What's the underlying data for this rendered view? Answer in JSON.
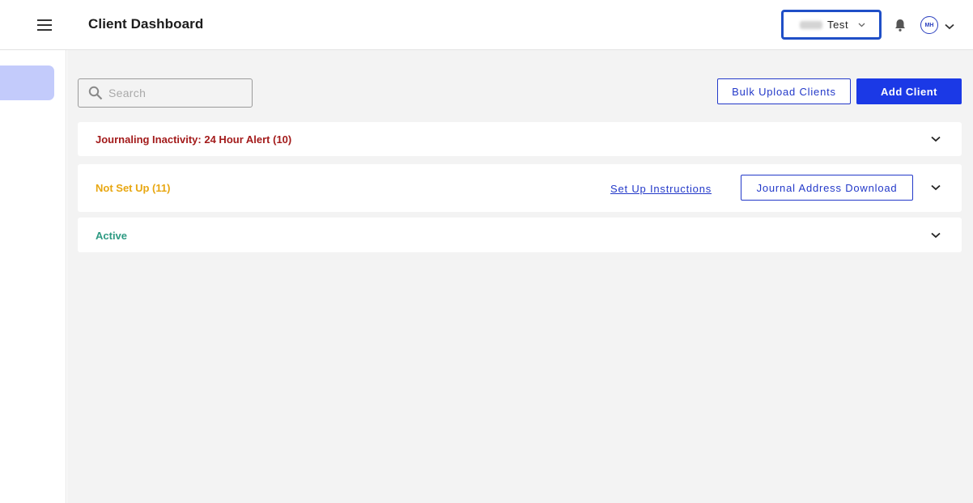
{
  "header": {
    "title": "Client Dashboard",
    "org_selector": {
      "selected": "Test"
    },
    "user": {
      "initials": "MH"
    }
  },
  "toolbar": {
    "search_placeholder": "Search",
    "bulk_upload_label": "Bulk Upload Clients",
    "add_client_label": "Add Client"
  },
  "panels": [
    {
      "title": "Journaling Inactivity: 24 Hour Alert (10)",
      "color": "#a31b1b"
    },
    {
      "title": "Not Set Up (11)",
      "color": "#e8a712",
      "link_label": "Set Up Instructions",
      "button_label": "Journal Address Download"
    },
    {
      "title": "Active",
      "color": "#2d9a82"
    }
  ],
  "icons": [
    "menu-icon",
    "bell-icon",
    "chevron-down-icon",
    "search-icon"
  ],
  "colors": {
    "accent": "#1b39e6",
    "sidebar_active": "#c3cbfb",
    "org_highlight": "#1f4fc7"
  }
}
